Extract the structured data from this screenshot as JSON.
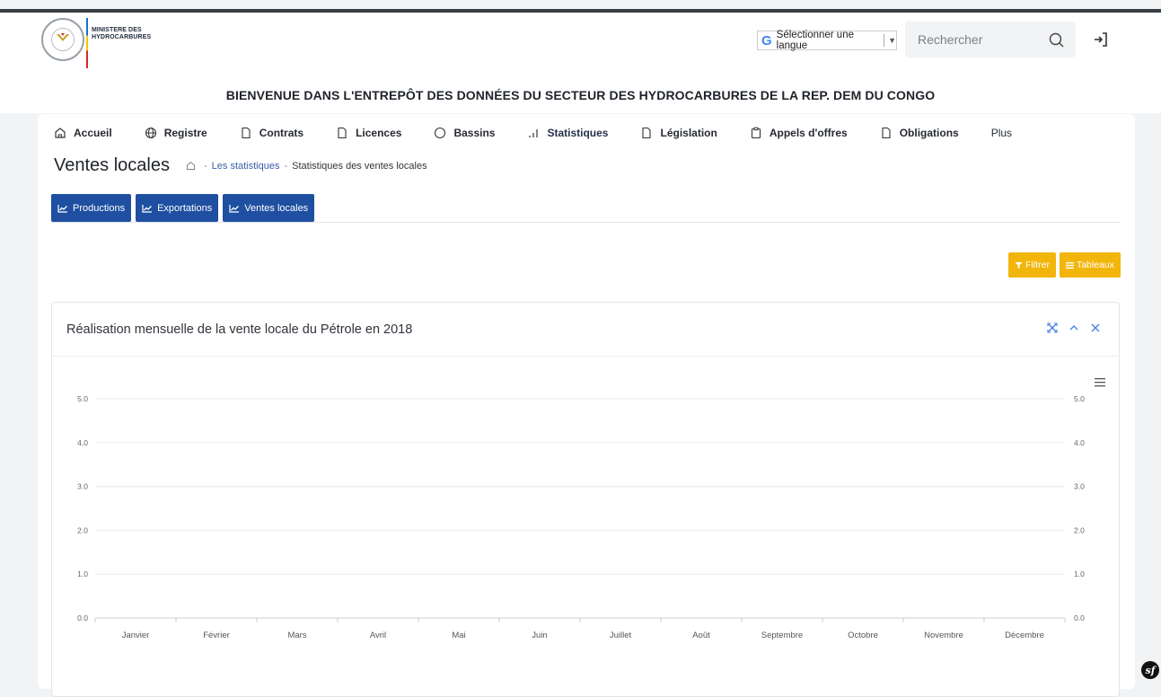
{
  "header": {
    "ministry_line1": "MINISTERE DES",
    "ministry_line2": "HYDROCARBURES",
    "language_label": "Sélectionner une langue",
    "language_caret": "▼",
    "search_placeholder": "Rechercher",
    "welcome": "BIENVENUE DANS L'ENTREPÔT DES DONNÉES DU SECTEUR DES HYDROCARBURES DE LA REP. DEM DU CONGO"
  },
  "nav": {
    "items": [
      {
        "label": "Accueil",
        "icon": "home-icon"
      },
      {
        "label": "Registre",
        "icon": "globe-icon"
      },
      {
        "label": "Contrats",
        "icon": "file-icon"
      },
      {
        "label": "Licences",
        "icon": "file-icon"
      },
      {
        "label": "Bassins",
        "icon": "circle-icon"
      },
      {
        "label": "Statistiques",
        "icon": "bar-signal-icon"
      },
      {
        "label": "Législation",
        "icon": "file-icon"
      },
      {
        "label": "Appels d'offres",
        "icon": "clipboard-icon"
      },
      {
        "label": "Obligations",
        "icon": "file-icon"
      },
      {
        "label": "Plus",
        "icon": ""
      }
    ]
  },
  "page": {
    "title": "Ventes locales",
    "breadcrumb": [
      "Les statistiques",
      "Statistiques des ventes locales"
    ],
    "breadcrumb_sep": "-"
  },
  "tabs": [
    "Productions",
    "Exportations",
    "Ventes locales"
  ],
  "actions": {
    "filter_label": "Filtrer",
    "tables_label": "Tableaux"
  },
  "card": {
    "title": "Réalisation mensuelle de la vente locale du Pétrole en 2018"
  },
  "colors": {
    "primary": "#1e4fa1",
    "accent": "#f2b50c",
    "tools": "#3f7ee0"
  },
  "chart_data": {
    "type": "line",
    "title": "",
    "categories": [
      "Janvier",
      "Février",
      "Mars",
      "Avril",
      "Mai",
      "Juin",
      "Juillet",
      "Août",
      "Septembre",
      "Octobre",
      "Novembre",
      "Décembre"
    ],
    "series": [],
    "ylim": [
      0,
      5
    ],
    "yticks": [
      "0.0",
      "1.0",
      "2.0",
      "3.0",
      "4.0",
      "5.0"
    ],
    "secondary_yticks": [
      "0.0",
      "1.0",
      "2.0",
      "3.0",
      "4.0",
      "5.0"
    ],
    "grid": true,
    "xlabel": "",
    "ylabel": ""
  },
  "footer": {
    "badge": "sf"
  }
}
